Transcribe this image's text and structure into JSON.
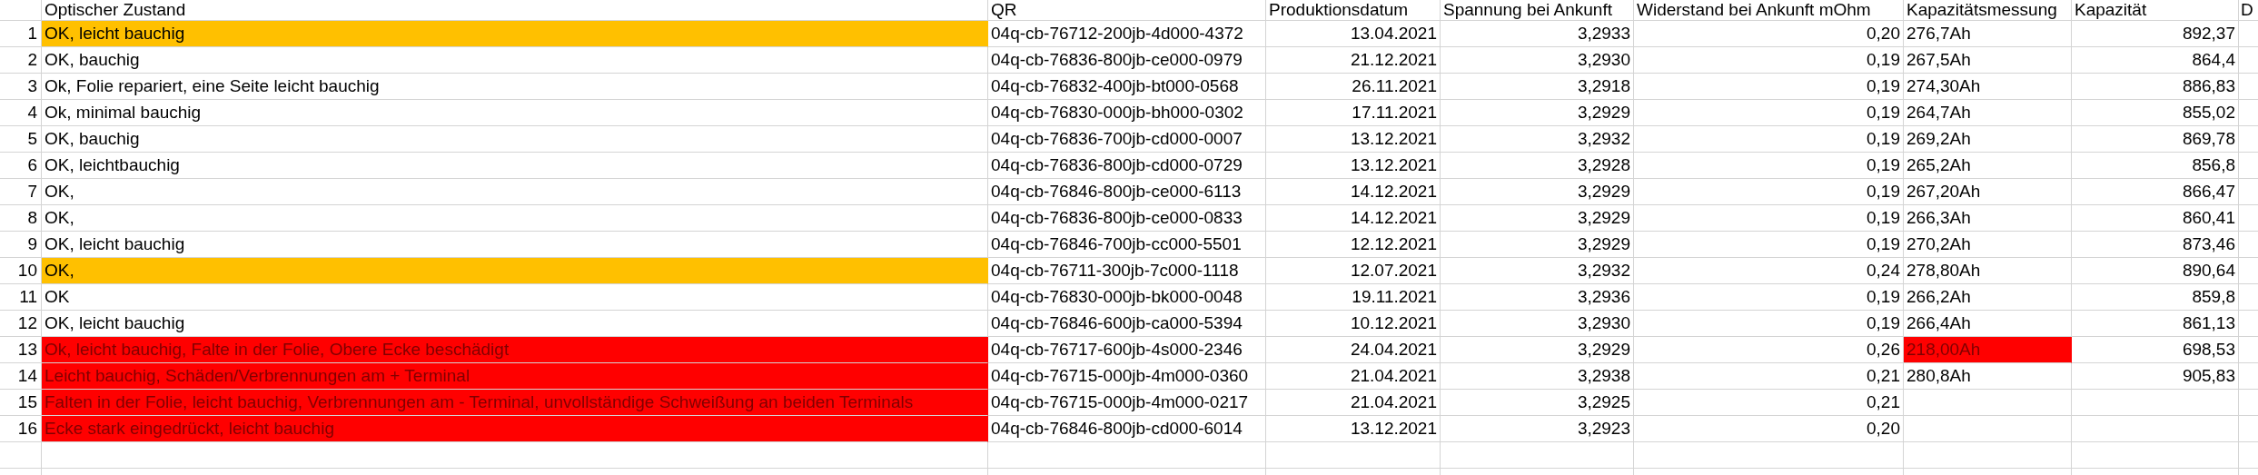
{
  "columns": [
    {
      "label": "Optischer Zustand",
      "kind": "text"
    },
    {
      "label": "QR",
      "kind": "text"
    },
    {
      "label": "Produktionsdatum",
      "kind": "number"
    },
    {
      "label": "Spannung bei Ankunft",
      "kind": "number"
    },
    {
      "label": "Widerstand bei Ankunft mOhm",
      "kind": "number"
    },
    {
      "label": "Kapazitätsmessung",
      "kind": "text"
    },
    {
      "label": "Kapazität",
      "kind": "number"
    },
    {
      "label": "D",
      "kind": "text"
    }
  ],
  "rows": [
    {
      "number": "1",
      "cells": [
        {
          "text": "OK, leicht bauchig",
          "color": "#ffc000"
        },
        {
          "text": "04q-cb-76712-200jb-4d000-4372"
        },
        {
          "text": "13.04.2021"
        },
        {
          "text": "3,2933"
        },
        {
          "text": "0,20"
        },
        {
          "text": "276,7Ah"
        },
        {
          "text": "892,37"
        }
      ]
    },
    {
      "number": "2",
      "cells": [
        {
          "text": "OK, bauchig"
        },
        {
          "text": "04q-cb-76836-800jb-ce000-0979"
        },
        {
          "text": "21.12.2021"
        },
        {
          "text": "3,2930"
        },
        {
          "text": "0,19"
        },
        {
          "text": "267,5Ah"
        },
        {
          "text": "864,4"
        }
      ]
    },
    {
      "number": "3",
      "cells": [
        {
          "text": "Ok, Folie repariert, eine Seite leicht bauchig"
        },
        {
          "text": "04q-cb-76832-400jb-bt000-0568"
        },
        {
          "text": "26.11.2021"
        },
        {
          "text": "3,2918"
        },
        {
          "text": "0,19"
        },
        {
          "text": "274,30Ah"
        },
        {
          "text": "886,83"
        }
      ]
    },
    {
      "number": "4",
      "cells": [
        {
          "text": "Ok, minimal bauchig"
        },
        {
          "text": "04q-cb-76830-000jb-bh000-0302"
        },
        {
          "text": "17.11.2021"
        },
        {
          "text": "3,2929"
        },
        {
          "text": "0,19"
        },
        {
          "text": "264,7Ah"
        },
        {
          "text": "855,02"
        }
      ]
    },
    {
      "number": "5",
      "cells": [
        {
          "text": "OK, bauchig"
        },
        {
          "text": "04q-cb-76836-700jb-cd000-0007"
        },
        {
          "text": "13.12.2021"
        },
        {
          "text": "3,2932"
        },
        {
          "text": "0,19"
        },
        {
          "text": "269,2Ah"
        },
        {
          "text": "869,78"
        }
      ]
    },
    {
      "number": "6",
      "cells": [
        {
          "text": "OK, leichtbauchig"
        },
        {
          "text": "04q-cb-76836-800jb-cd000-0729"
        },
        {
          "text": "13.12.2021"
        },
        {
          "text": "3,2928"
        },
        {
          "text": "0,19"
        },
        {
          "text": "265,2Ah"
        },
        {
          "text": "856,8"
        }
      ]
    },
    {
      "number": "7",
      "cells": [
        {
          "text": "OK,"
        },
        {
          "text": "04q-cb-76846-800jb-ce000-6113"
        },
        {
          "text": "14.12.2021"
        },
        {
          "text": "3,2929"
        },
        {
          "text": "0,19"
        },
        {
          "text": "267,20Ah"
        },
        {
          "text": "866,47"
        }
      ]
    },
    {
      "number": "8",
      "cells": [
        {
          "text": "OK,"
        },
        {
          "text": "04q-cb-76836-800jb-ce000-0833"
        },
        {
          "text": "14.12.2021"
        },
        {
          "text": "3,2929"
        },
        {
          "text": "0,19"
        },
        {
          "text": "266,3Ah"
        },
        {
          "text": "860,41"
        }
      ]
    },
    {
      "number": "9",
      "cells": [
        {
          "text": "OK, leicht bauchig"
        },
        {
          "text": "04q-cb-76846-700jb-cc000-5501"
        },
        {
          "text": "12.12.2021"
        },
        {
          "text": "3,2929"
        },
        {
          "text": "0,19"
        },
        {
          "text": "270,2Ah"
        },
        {
          "text": "873,46"
        }
      ]
    },
    {
      "number": "10",
      "cells": [
        {
          "text": "OK,",
          "color": "#ffc000"
        },
        {
          "text": "04q-cb-76711-300jb-7c000-1118"
        },
        {
          "text": "12.07.2021"
        },
        {
          "text": "3,2932"
        },
        {
          "text": "0,24"
        },
        {
          "text": "278,80Ah"
        },
        {
          "text": "890,64"
        }
      ]
    },
    {
      "number": "11",
      "cells": [
        {
          "text": "OK"
        },
        {
          "text": "04q-cb-76830-000jb-bk000-0048"
        },
        {
          "text": "19.11.2021"
        },
        {
          "text": "3,2936"
        },
        {
          "text": "0,19"
        },
        {
          "text": "266,2Ah"
        },
        {
          "text": "859,8"
        }
      ]
    },
    {
      "number": "12",
      "cells": [
        {
          "text": "OK, leicht bauchig"
        },
        {
          "text": "04q-cb-76846-600jb-ca000-5394"
        },
        {
          "text": "10.12.2021"
        },
        {
          "text": "3,2930"
        },
        {
          "text": "0,19"
        },
        {
          "text": "266,4Ah"
        },
        {
          "text": "861,13"
        }
      ]
    },
    {
      "number": "13",
      "cells": [
        {
          "text": "Ok, leicht bauchig, Falte in der Folie, Obere Ecke beschädigt",
          "color": "#ff0000"
        },
        {
          "text": "04q-cb-76717-600jb-4s000-2346"
        },
        {
          "text": "24.04.2021"
        },
        {
          "text": "3,2929"
        },
        {
          "text": "0,26"
        },
        {
          "text": "218,00Ah",
          "color": "#ff0000"
        },
        {
          "text": "698,53"
        }
      ]
    },
    {
      "number": "14",
      "cells": [
        {
          "text": "Leicht bauchig, Schäden/Verbrennungen am + Terminal",
          "color": "#ff0000"
        },
        {
          "text": "04q-cb-76715-000jb-4m000-0360"
        },
        {
          "text": "21.04.2021"
        },
        {
          "text": "3,2938"
        },
        {
          "text": "0,21"
        },
        {
          "text": "280,8Ah"
        },
        {
          "text": "905,83"
        }
      ]
    },
    {
      "number": "15",
      "cells": [
        {
          "text": "Falten in der Folie, leicht bauchig, Verbrennungen am - Terminal, unvollständige Schweißung an beiden Terminals",
          "color": "#ff0000"
        },
        {
          "text": "04q-cb-76715-000jb-4m000-0217"
        },
        {
          "text": "21.04.2021"
        },
        {
          "text": "3,2925"
        },
        {
          "text": "0,21"
        },
        {},
        {}
      ]
    },
    {
      "number": "16",
      "cells": [
        {
          "text": "Ecke stark eingedrückt, leicht bauchig",
          "color": "#ff0000"
        },
        {
          "text": "04q-cb-76846-800jb-cd000-6014"
        },
        {
          "text": "13.12.2021"
        },
        {
          "text": "3,2923"
        },
        {
          "text": "0,20"
        },
        {},
        {}
      ]
    }
  ]
}
